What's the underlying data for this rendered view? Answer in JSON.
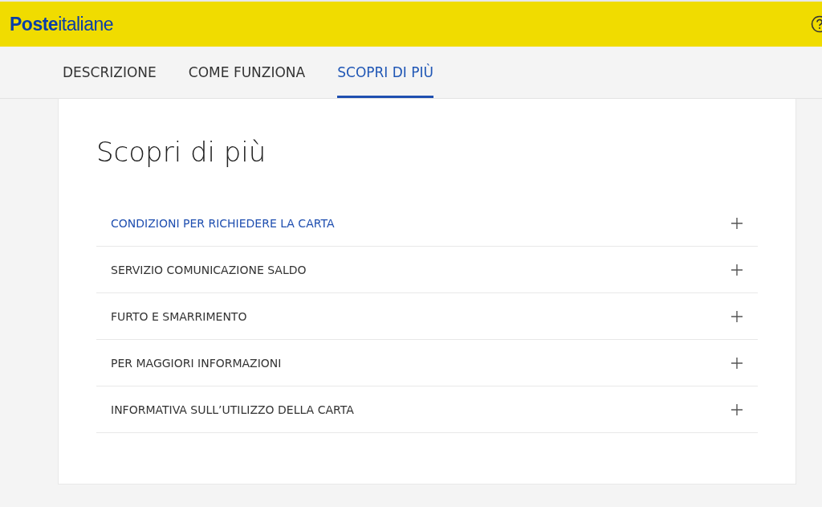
{
  "header": {
    "logo": "**Poste**italiane"
  },
  "tabs": [
    {
      "label": "DESCRIZIONE",
      "selected": false
    },
    {
      "label": "COME FUNZIONA",
      "selected": false
    },
    {
      "label": "SCOPRI DI PIÙ",
      "selected": true
    }
  ],
  "section": {
    "title": "Scopri di più",
    "accordion": [
      {
        "label": "CONDIZIONI PER RICHIEDERE LA CARTA",
        "selected": true,
        "expanded": false
      },
      {
        "label": "SERVIZIO COMUNICAZIONE SALDO",
        "selected": false,
        "expanded": false
      },
      {
        "label": "FURTO E SMARRIMENTO",
        "selected": false,
        "expanded": false
      },
      {
        "label": "PER MAGGIORI INFORMAZIONI",
        "selected": false,
        "expanded": false
      },
      {
        "label": "INFORMATIVA SULL’UTILIZZO DELLA CARTA",
        "selected": false,
        "expanded": false
      }
    ]
  }
}
